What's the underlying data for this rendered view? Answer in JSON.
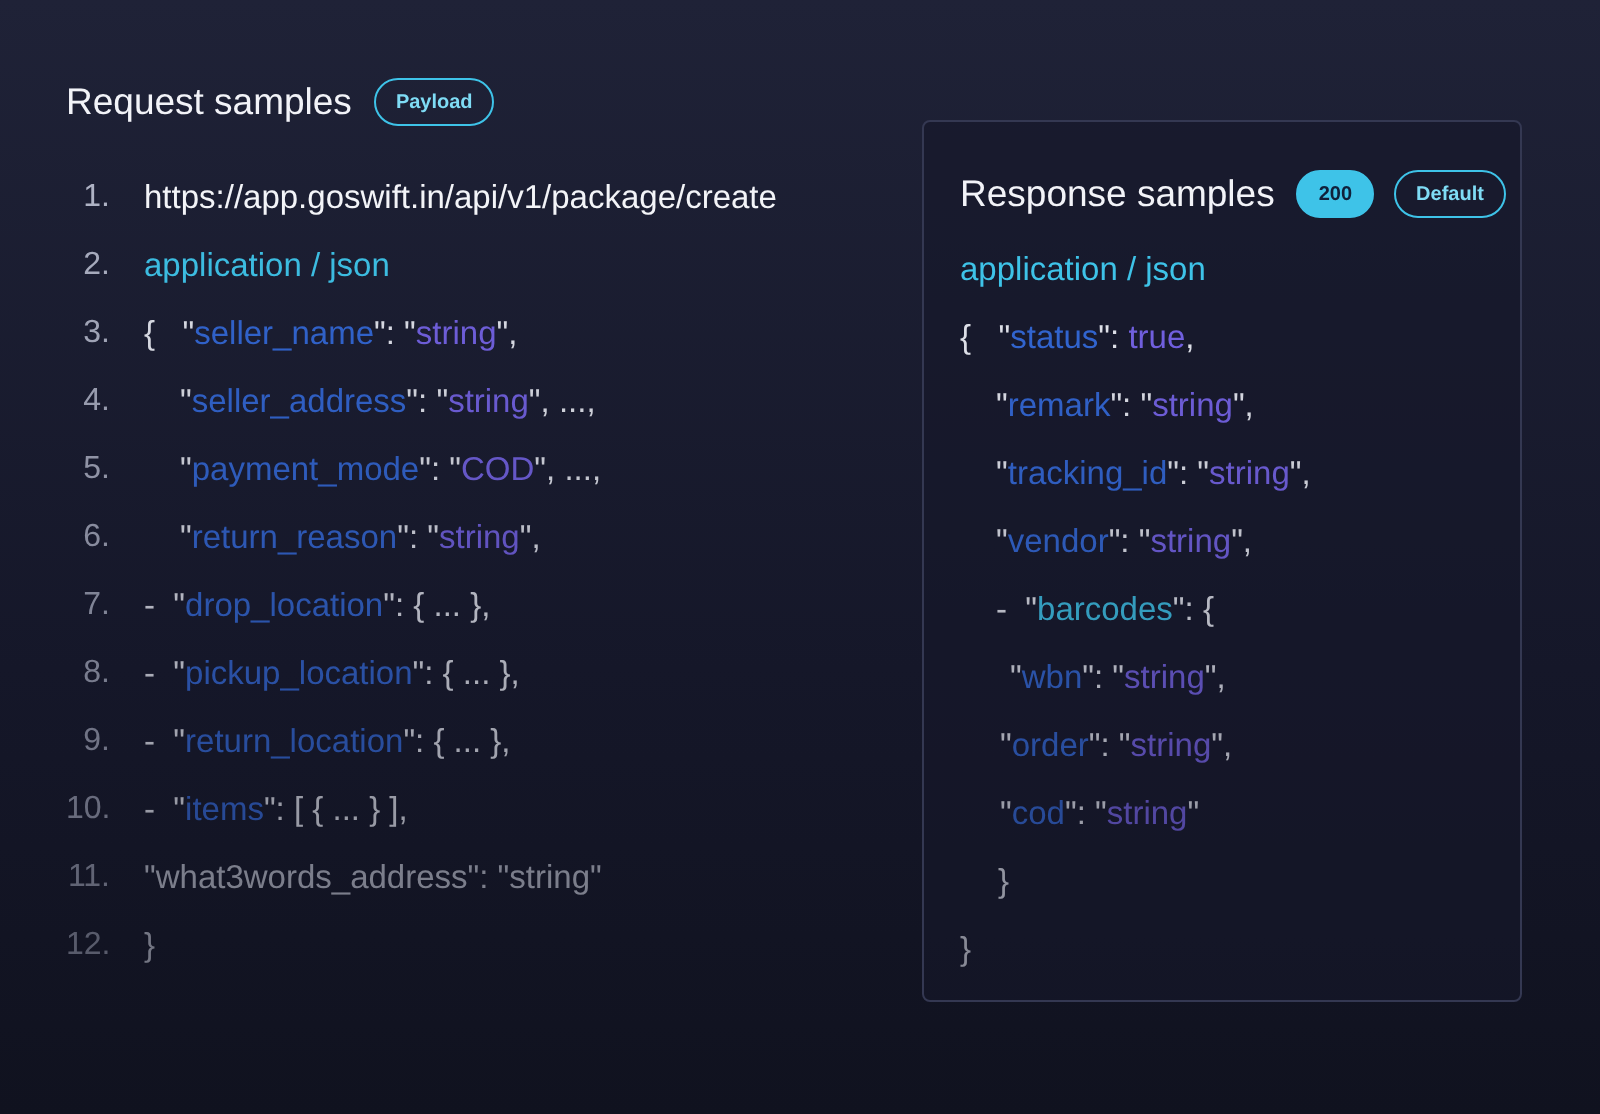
{
  "request": {
    "title": "Request samples",
    "badges": [
      {
        "label": "Payload",
        "kind": "outline"
      }
    ],
    "lines": [
      {
        "number": "1.",
        "kind": "top",
        "tokens": [
          {
            "kind": "plain",
            "text": "https://app.goswift.in/api/v1/package/create"
          }
        ]
      },
      {
        "number": "2.",
        "kind": "top",
        "tokens": [
          {
            "kind": "mime",
            "text": "application / json"
          }
        ]
      },
      {
        "number": "3.",
        "kind": "top",
        "tokens": [
          {
            "kind": "punct",
            "text": "{   \""
          },
          {
            "kind": "key",
            "text": "seller_name"
          },
          {
            "kind": "punct",
            "text": "\": \""
          },
          {
            "kind": "value",
            "text": "string"
          },
          {
            "kind": "punct",
            "text": "\","
          }
        ]
      },
      {
        "number": "4.",
        "kind": "nested",
        "tokens": [
          {
            "kind": "punct",
            "text": "\""
          },
          {
            "kind": "key",
            "text": "seller_address"
          },
          {
            "kind": "punct",
            "text": "\": \""
          },
          {
            "kind": "value",
            "text": "string"
          },
          {
            "kind": "punct",
            "text": "\", ...,"
          }
        ]
      },
      {
        "number": "5.",
        "kind": "nested",
        "tokens": [
          {
            "kind": "punct",
            "text": "\""
          },
          {
            "kind": "key",
            "text": "payment_mode"
          },
          {
            "kind": "punct",
            "text": "\": \""
          },
          {
            "kind": "value",
            "text": "COD"
          },
          {
            "kind": "punct",
            "text": "\", ...,"
          }
        ]
      },
      {
        "number": "6.",
        "kind": "nested",
        "tokens": [
          {
            "kind": "punct",
            "text": "\""
          },
          {
            "kind": "key",
            "text": "return_reason"
          },
          {
            "kind": "punct",
            "text": "\": \""
          },
          {
            "kind": "value",
            "text": "string"
          },
          {
            "kind": "punct",
            "text": "\","
          }
        ]
      },
      {
        "number": "7.",
        "kind": "top",
        "tokens": [
          {
            "kind": "punct",
            "text": "-  \""
          },
          {
            "kind": "key",
            "text": "drop_location"
          },
          {
            "kind": "punct",
            "text": "\": { ... },"
          }
        ]
      },
      {
        "number": "8.",
        "kind": "top",
        "tokens": [
          {
            "kind": "punct",
            "text": "-  \""
          },
          {
            "kind": "key",
            "text": "pickup_location"
          },
          {
            "kind": "punct",
            "text": "\": { ... },"
          }
        ]
      },
      {
        "number": "9.",
        "kind": "top",
        "tokens": [
          {
            "kind": "punct",
            "text": "-  \""
          },
          {
            "kind": "key",
            "text": "return_location"
          },
          {
            "kind": "punct",
            "text": "\": { ... },"
          }
        ]
      },
      {
        "number": "10.",
        "kind": "top",
        "tokens": [
          {
            "kind": "punct",
            "text": "-  \""
          },
          {
            "kind": "key",
            "text": "items"
          },
          {
            "kind": "punct",
            "text": "\": [ { ... } ],"
          }
        ]
      },
      {
        "number": "11.",
        "kind": "top",
        "tokens": [
          {
            "kind": "muted",
            "text": "\"what3words_address\": \"string\""
          }
        ]
      },
      {
        "number": "12.",
        "kind": "top",
        "tokens": [
          {
            "kind": "muted",
            "text": "}"
          }
        ]
      }
    ]
  },
  "response": {
    "title": "Response samples",
    "badges": [
      {
        "label": "200",
        "kind": "filled"
      },
      {
        "label": "Default",
        "kind": "outline"
      }
    ],
    "lines": [
      {
        "kind": "top",
        "tokens": [
          {
            "kind": "mime",
            "text": "application / json"
          }
        ]
      },
      {
        "kind": "top",
        "tokens": [
          {
            "kind": "punct",
            "text": "{   \""
          },
          {
            "kind": "key",
            "text": "status"
          },
          {
            "kind": "punct",
            "text": "\": "
          },
          {
            "kind": "value",
            "text": "true"
          },
          {
            "kind": "punct",
            "text": ","
          }
        ]
      },
      {
        "kind": "nested",
        "tokens": [
          {
            "kind": "punct",
            "text": "\""
          },
          {
            "kind": "key",
            "text": "remark"
          },
          {
            "kind": "punct",
            "text": "\": \""
          },
          {
            "kind": "value",
            "text": "string"
          },
          {
            "kind": "punct",
            "text": "\","
          }
        ]
      },
      {
        "kind": "nested",
        "tokens": [
          {
            "kind": "punct",
            "text": "\""
          },
          {
            "kind": "key",
            "text": "tracking_id"
          },
          {
            "kind": "punct",
            "text": "\": \""
          },
          {
            "kind": "value",
            "text": "string"
          },
          {
            "kind": "punct",
            "text": "\","
          }
        ]
      },
      {
        "kind": "nested",
        "tokens": [
          {
            "kind": "punct",
            "text": "\""
          },
          {
            "kind": "key",
            "text": "vendor"
          },
          {
            "kind": "punct",
            "text": "\": \""
          },
          {
            "kind": "value",
            "text": "string"
          },
          {
            "kind": "punct",
            "text": "\","
          }
        ]
      },
      {
        "kind": "nested",
        "tokens": [
          {
            "kind": "punct",
            "text": "-  \""
          },
          {
            "kind": "mime",
            "text": "barcodes"
          },
          {
            "kind": "punct",
            "text": "\": {"
          }
        ]
      },
      {
        "kind": "deepest",
        "tokens": [
          {
            "kind": "punct",
            "text": "\""
          },
          {
            "kind": "key",
            "text": "wbn"
          },
          {
            "kind": "punct",
            "text": "\": \""
          },
          {
            "kind": "value",
            "text": "string"
          },
          {
            "kind": "punct",
            "text": "\","
          }
        ]
      },
      {
        "kind": "deep",
        "tokens": [
          {
            "kind": "punct",
            "text": "\""
          },
          {
            "kind": "key",
            "text": "order"
          },
          {
            "kind": "punct",
            "text": "\": \""
          },
          {
            "kind": "value",
            "text": "string"
          },
          {
            "kind": "punct",
            "text": "\","
          }
        ]
      },
      {
        "kind": "deep",
        "tokens": [
          {
            "kind": "punct",
            "text": "\""
          },
          {
            "kind": "key",
            "text": "cod"
          },
          {
            "kind": "punct",
            "text": "\": \""
          },
          {
            "kind": "value",
            "text": "string"
          },
          {
            "kind": "punct",
            "text": "\""
          }
        ]
      },
      {
        "kind": "close",
        "tokens": [
          {
            "kind": "punct",
            "text": "}"
          }
        ]
      },
      {
        "kind": "top",
        "tokens": [
          {
            "kind": "punct",
            "text": "}"
          }
        ]
      }
    ]
  }
}
